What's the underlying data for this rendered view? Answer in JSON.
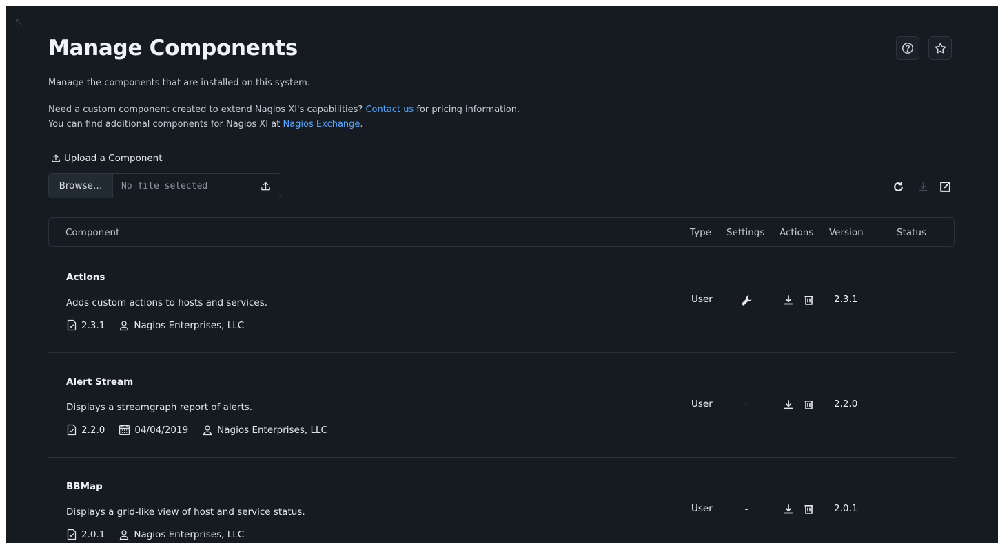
{
  "page": {
    "title": "Manage Components",
    "description": "Manage the components that are installed on this system.",
    "custom_line": {
      "prefix": "Need a custom component created to extend Nagios XI's capabilities?",
      "link": "Contact us",
      "suffix": "for pricing information."
    },
    "exchange_line": {
      "prefix": "You can find additional components for Nagios XI at",
      "link": "Nagios Exchange",
      "suffix": "."
    }
  },
  "header_icons": [
    "help-icon",
    "star-icon"
  ],
  "upload": {
    "label": "Upload a Component",
    "browse_label": "Browse…",
    "file_placeholder": "No file selected"
  },
  "toolbar_icons": [
    "refresh-icon",
    "download-icon",
    "external-link-icon"
  ],
  "table": {
    "columns": {
      "component": "Component",
      "type": "Type",
      "settings": "Settings",
      "actions": "Actions",
      "version": "Version",
      "status": "Status"
    },
    "rows": [
      {
        "name": "Actions",
        "description": "Adds custom actions to hosts and services.",
        "meta_version": "2.3.1",
        "meta_date": "",
        "author": "Nagios Enterprises, LLC",
        "type": "User",
        "settings": "",
        "version": "2.3.1",
        "status": ""
      },
      {
        "name": "Alert Stream",
        "description": "Displays a streamgraph report of alerts.",
        "meta_version": "2.2.0",
        "meta_date": "04/04/2019",
        "author": "Nagios Enterprises, LLC",
        "type": "User",
        "settings": "-",
        "version": "2.2.0",
        "status": ""
      },
      {
        "name": "BBMap",
        "description": "Displays a grid-like view of host and service status.",
        "meta_version": "2.0.1",
        "meta_date": "",
        "author": "Nagios Enterprises, LLC",
        "type": "User",
        "settings": "-",
        "version": "2.0.1",
        "status": ""
      }
    ]
  },
  "colors": {
    "background": "#161b22",
    "link": "#58a6ff",
    "border": "#2a313b"
  }
}
